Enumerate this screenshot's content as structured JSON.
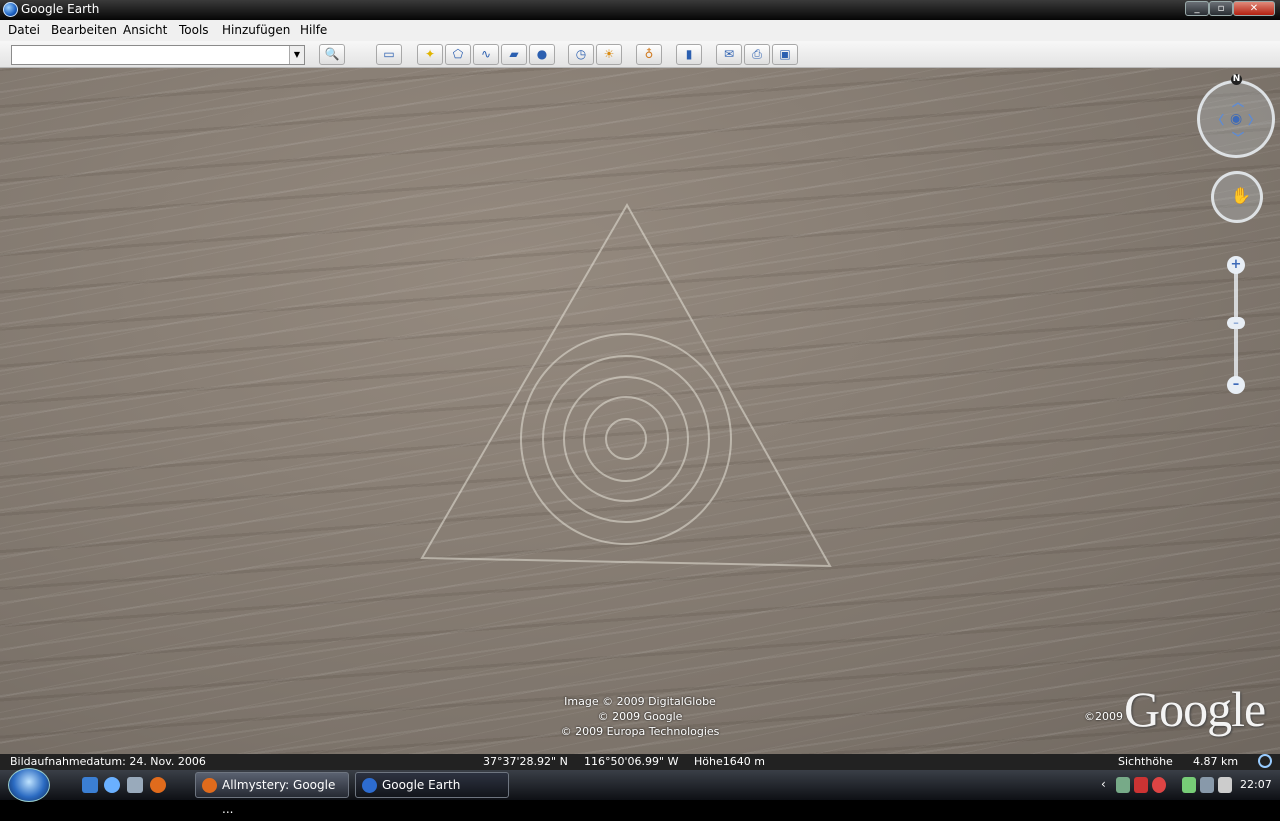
{
  "window": {
    "title": "Google Earth",
    "controls": [
      "minimize",
      "maximize",
      "close"
    ]
  },
  "menu": {
    "items": [
      "Datei",
      "Bearbeiten",
      "Ansicht",
      "Tools",
      "Hinzufügen",
      "Hilfe"
    ]
  },
  "search": {
    "value": "",
    "placeholder": ""
  },
  "toolbar": {
    "icons": [
      "search-icon",
      "sidebar-icon",
      "placemark-icon",
      "polygon-icon",
      "path-icon",
      "overlay-icon",
      "tour-icon",
      "historical-imagery-icon",
      "sunlight-icon",
      "planets-icon",
      "ruler-icon",
      "email-icon",
      "print-icon",
      "view-in-maps-icon"
    ]
  },
  "map": {
    "credits": [
      "Image © 2009 DigitalGlobe",
      "© 2009 Google",
      "© 2009 Europa Technologies"
    ],
    "logo": "Google",
    "logo_copyright": "©2009",
    "compass_n": "N"
  },
  "statusbar": {
    "date": "Bildaufnahmedatum: 24. Nov. 2006",
    "lat": "37°37'28.92\"  N",
    "lon": "116°50'06.99\"  W",
    "elevation": "Höhe1640 m",
    "eye_alt_label": "Sichthöhe",
    "eye_alt": "4.87 km"
  },
  "taskbar": {
    "tasks": [
      {
        "label": "Allmystery: Google ...",
        "icon": "firefox-icon",
        "active": false
      },
      {
        "label": "Google Earth",
        "icon": "google-earth-icon",
        "active": true
      }
    ],
    "clock": "22:07"
  }
}
